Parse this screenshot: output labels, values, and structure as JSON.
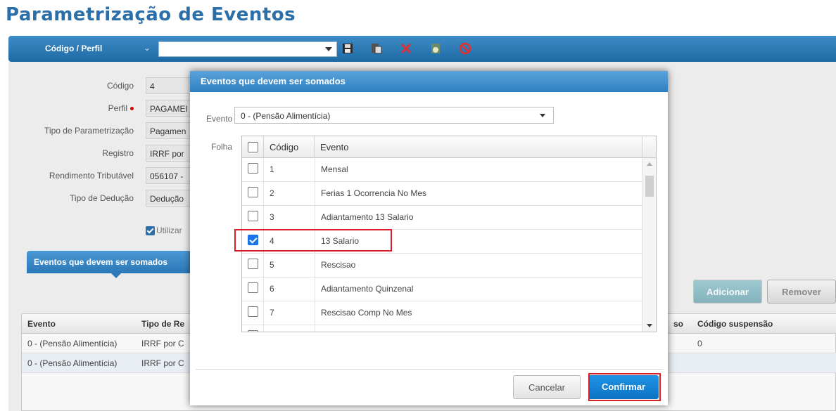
{
  "page": {
    "title": "Parametrização de Eventos"
  },
  "toolbar": {
    "label": "Código / Perfil",
    "select_value": "",
    "icons": [
      "save-icon",
      "copy-icon",
      "delete-icon",
      "export-icon",
      "cancel-icon"
    ]
  },
  "form": {
    "codigo_label": "Código",
    "codigo_value": "4",
    "perfil_label": "Perfil",
    "perfil_value": "PAGAMEI",
    "tipo_param_label": "Tipo de Parametrização",
    "tipo_param_value": "Pagamen",
    "registro_label": "Registro",
    "registro_value": "IRRF por",
    "rend_label": "Rendimento Tributável",
    "rend_value": "056107 -",
    "deducao_label": "Tipo de Dedução",
    "deducao_value": "Dedução",
    "utilizar_label": "Utilizar"
  },
  "section": {
    "tab_label": "Eventos que devem ser somados"
  },
  "actions": {
    "adicionar": "Adicionar",
    "remover": "Remover"
  },
  "bg_grid": {
    "headers": [
      "Evento",
      "Tipo de Re",
      "so",
      "Código suspensão"
    ],
    "rows": [
      [
        "0 - (Pensão Alimentícia)",
        "IRRF por C",
        "",
        "0"
      ],
      [
        "0 - (Pensão Alimentícia)",
        "IRRF por C",
        "",
        ""
      ]
    ]
  },
  "modal": {
    "title": "Eventos que devem ser somados",
    "evento_label": "Evento",
    "evento_value": "0 - (Pensão Alimentícia)",
    "folha_label": "Folha",
    "columns": [
      "Código",
      "Evento"
    ],
    "rows": [
      {
        "codigo": "1",
        "evento": "Mensal",
        "checked": false
      },
      {
        "codigo": "2",
        "evento": "Ferias 1 Ocorrencia No Mes",
        "checked": false
      },
      {
        "codigo": "3",
        "evento": "Adiantamento 13 Salario",
        "checked": false
      },
      {
        "codigo": "4",
        "evento": "13 Salario",
        "checked": true
      },
      {
        "codigo": "5",
        "evento": "Rescisao",
        "checked": false
      },
      {
        "codigo": "6",
        "evento": "Adiantamento Quinzenal",
        "checked": false
      },
      {
        "codigo": "7",
        "evento": "Rescisao Comp No Mes",
        "checked": false
      }
    ],
    "cancel_label": "Cancelar",
    "confirm_label": "Confirmar"
  },
  "colors": {
    "accent": "#2f80c2",
    "highlight": "#d61f26",
    "confirm": "#0d74c4"
  }
}
